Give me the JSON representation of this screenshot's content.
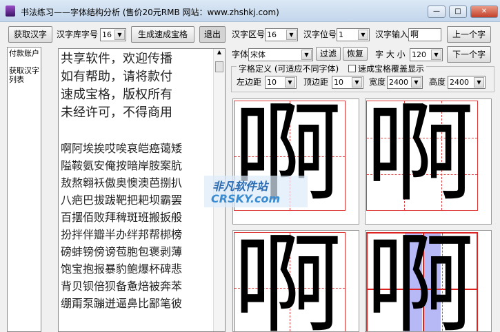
{
  "window": {
    "title": "书法练习——字体结构分析 (售价20元RMB   网站：www.zhshkj.com)",
    "min": "—",
    "max": "□",
    "close": "✕"
  },
  "toolbar": {
    "get_chars": "获取汉字",
    "lib_size_label": "汉字库字号",
    "lib_size": "16",
    "generate": "生成速成宝格",
    "exit": "退出",
    "zone_label": "汉字区号",
    "zone": "16",
    "pos_label": "汉字位号",
    "pos": "1",
    "input_label": "汉字输入",
    "input_value": "啊",
    "prev": "上一个字",
    "next": "下一个字"
  },
  "font_row": {
    "font_label": "字体",
    "font": "宋体",
    "filter": "过滤",
    "restore": "恢复",
    "size_label": "字 大 小",
    "size": "120"
  },
  "grid_def": {
    "legend": "字格定义 (可适应不同字体)",
    "overlay_label": "速成宝格覆盖显示",
    "overlay_checked": false,
    "left_label": "左边距",
    "left": "10",
    "top_label": "顶边距",
    "top": "10",
    "width_label": "宽度",
    "width": "2400",
    "height_label": "高度",
    "height": "2400"
  },
  "left_list": [
    "付款账户",
    "获取汉字列表"
  ],
  "text_lines": [
    "共享软件，欢迎传播",
    "如有帮助，请将款付",
    "速成宝格，版权所有",
    "未经许可，不得商用",
    "",
    "啊阿埃挨哎唉哀皑癌蔼矮",
    "隘鞍氨安俺按暗岸胺案肮",
    "敖熬翱袄傲奥懊澳芭捌扒",
    "八疤巴拔跋靶把耙坝霸罢",
    "百摆佰败拜稗斑班搬扳般",
    "扮拌伴瓣半办绊邦帮梆榜",
    "磅蚌镑傍谤苞胞包褒剥薄",
    "饱宝抱报暴豹鲍爆杯碑悲",
    "背贝钡倍狈备惫焙被奔苯",
    "绷甭泵蹦迸逼鼻比鄙笔彼"
  ],
  "preview_char": "啊",
  "watermark": {
    "cn": "非凡软件站",
    "en": "CRSKY.com"
  }
}
